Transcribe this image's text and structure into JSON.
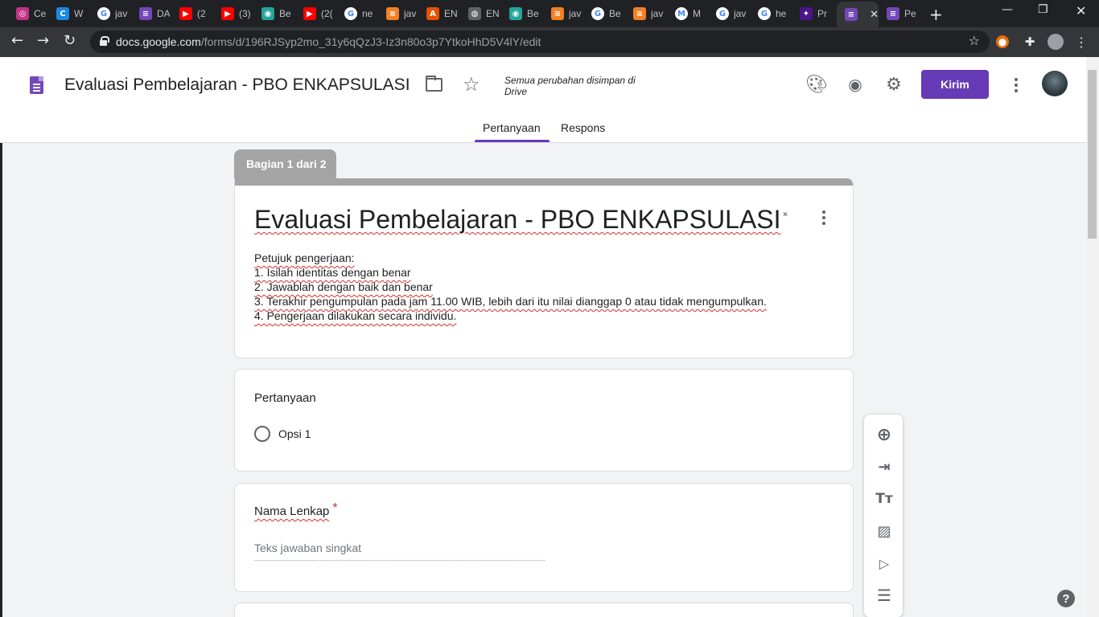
{
  "browser": {
    "tabs": [
      {
        "label": "Ce",
        "icon": "instagram-icon",
        "color": "#c13584",
        "glyph": "◎"
      },
      {
        "label": "W",
        "icon": "canva-icon",
        "color": "#1e88e5",
        "glyph": "C"
      },
      {
        "label": "jav",
        "icon": "google-icon",
        "color": "#ffffff",
        "glyph": "G"
      },
      {
        "label": "DA",
        "icon": "forms-icon",
        "color": "#7248b9",
        "glyph": "≡"
      },
      {
        "label": "(2",
        "icon": "youtube-icon",
        "color": "#ff0000",
        "glyph": "▶"
      },
      {
        "label": "(3)",
        "icon": "youtube-icon",
        "color": "#ff0000",
        "glyph": "▶"
      },
      {
        "label": "Be",
        "icon": "site-icon",
        "color": "#26a69a",
        "glyph": "◉"
      },
      {
        "label": "(2(",
        "icon": "youtube-icon",
        "color": "#ff0000",
        "glyph": "▶"
      },
      {
        "label": "ne",
        "icon": "google-icon",
        "color": "#ffffff",
        "glyph": "G"
      },
      {
        "label": "jav",
        "icon": "stackoverflow-icon",
        "color": "#f48024",
        "glyph": "≋"
      },
      {
        "label": "EN",
        "icon": "site-icon",
        "color": "#e65100",
        "glyph": "A"
      },
      {
        "label": "EN",
        "icon": "globe-icon",
        "color": "#5f6368",
        "glyph": "◍"
      },
      {
        "label": "Be",
        "icon": "site-icon",
        "color": "#26a69a",
        "glyph": "◉"
      },
      {
        "label": "jav",
        "icon": "stackoverflow-icon",
        "color": "#f48024",
        "glyph": "≋"
      },
      {
        "label": "Be",
        "icon": "github-icon",
        "color": "#ffffff",
        "glyph": "G"
      },
      {
        "label": "jav",
        "icon": "stackoverflow-icon",
        "color": "#f48024",
        "glyph": "≋"
      },
      {
        "label": "M",
        "icon": "medium-icon",
        "color": "#ffffff",
        "glyph": "M"
      },
      {
        "label": "jav",
        "icon": "google-icon",
        "color": "#ffffff",
        "glyph": "G"
      },
      {
        "label": "he",
        "icon": "google-icon",
        "color": "#ffffff",
        "glyph": "G"
      },
      {
        "label": "Pr",
        "icon": "site-icon",
        "color": "#4a148c",
        "glyph": "✦"
      },
      {
        "label": "",
        "icon": "forms-icon",
        "color": "#7248b9",
        "glyph": "≡"
      },
      {
        "label": "Pe",
        "icon": "forms-icon",
        "color": "#7248b9",
        "glyph": "≡"
      }
    ],
    "url_host": "docs.google.com",
    "url_path": "/forms/d/196RJSyp2mo_31y6qQzJ3-Iz3n80o3p7YtkoHhD5V4lY/edit"
  },
  "header": {
    "doc_title": "Evaluasi Pembelajaran - PBO ENKAPSULASI",
    "save_status": "Semua perubahan disimpan di Drive",
    "send_label": "Kirim"
  },
  "tabs": {
    "questions": "Pertanyaan",
    "responses": "Respons"
  },
  "form": {
    "section_label": "Bagian 1 dari 2",
    "title": "Evaluasi Pembelajaran - PBO ENKAPSULASI",
    "description": [
      "Petujuk pengerjaan:",
      "1. Isilah identitas dengan benar",
      "2. Jawablah dengan baik dan benar",
      "3. Terakhir pengumpulan pada jam 11.00 WIB, lebih dari itu nilai dianggap 0 atau tidak mengumpulkan.",
      "4. Pengerjaan dilakukan secara individu."
    ],
    "questions": [
      {
        "title": "Pertanyaan",
        "type": "multiple-choice",
        "options": [
          "Opsi 1"
        ]
      },
      {
        "title": "Nama Lenkap",
        "required": true,
        "required_mark": "*",
        "type": "short-answer",
        "placeholder": "Teks jawaban singkat"
      }
    ]
  },
  "colors": {
    "accent": "#673ab7",
    "header_strip": "#a4a4a4",
    "required": "#d93025"
  }
}
